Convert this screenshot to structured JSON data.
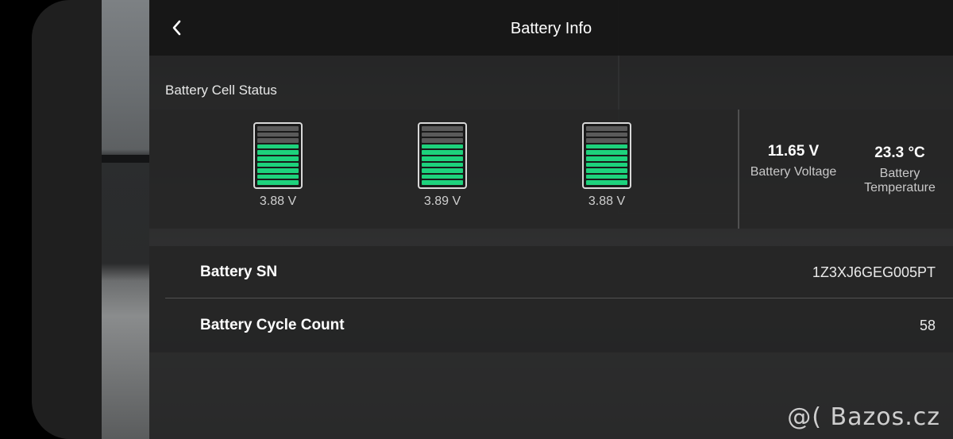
{
  "header": {
    "title": "Battery Info",
    "back_icon": "chevron-left-icon"
  },
  "cell_status": {
    "label": "Battery Cell Status",
    "cells": [
      {
        "voltage": "3.88 V",
        "level_fraction": 0.7
      },
      {
        "voltage": "3.89 V",
        "level_fraction": 0.7
      },
      {
        "voltage": "3.88 V",
        "level_fraction": 0.7
      }
    ],
    "accent_color": "#1dd27c"
  },
  "summary": {
    "voltage_value": "11.65 V",
    "voltage_label": "Battery Voltage",
    "temp_value": "23.3 °C",
    "temp_label_line1": "Battery",
    "temp_label_line2": "Temperature"
  },
  "details": [
    {
      "label": "Battery SN",
      "value": "1Z3XJ6GEG005PT"
    },
    {
      "label": "Battery Cycle Count",
      "value": "58"
    }
  ],
  "watermark": "@( Bazos.cz"
}
